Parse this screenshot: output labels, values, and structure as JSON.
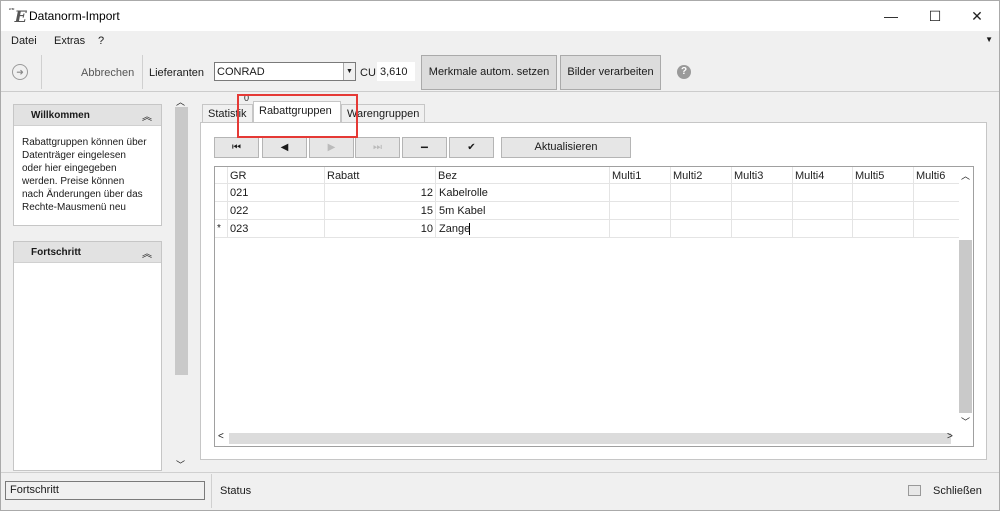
{
  "window": {
    "title": "Datanorm-Import",
    "minimize": "—",
    "maximize": "☐",
    "close": "✕",
    "logo": "E"
  },
  "menu": {
    "items": [
      "Datei",
      "Extras",
      "?"
    ]
  },
  "toolbar": {
    "abort_label": "Abbrechen",
    "supplier_label": "Lieferanten",
    "supplier_value": "CONRAD",
    "cu_label": "CU",
    "cu_value": "3,610",
    "auto_features_label": "Merkmale autom. setzen",
    "process_images_label": "Bilder verarbeiten"
  },
  "left_panel": {
    "welcome_title": "Willkommen",
    "welcome_text": "Rabattgruppen können über Datenträger eingelesen oder hier eingegeben werden. Preise können nach Änderungen über das Rechte-Mausmenü neu",
    "progress_title": "Fortschritt"
  },
  "tabs": {
    "hidden_label": "0",
    "items": [
      "Statistik",
      "Rabattgruppen",
      "Warengruppen"
    ],
    "active": 1
  },
  "nav": {
    "refresh_label": "Aktualisieren"
  },
  "grid": {
    "columns": [
      "GR",
      "Rabatt",
      "Bez",
      "Multi1",
      "Multi2",
      "Multi3",
      "Multi4",
      "Multi5",
      "Multi6"
    ],
    "rows": [
      {
        "marker": "",
        "gr": "021",
        "rabatt": "12",
        "bez": "Kabelrolle"
      },
      {
        "marker": "",
        "gr": "022",
        "rabatt": "15",
        "bez": "5m Kabel"
      },
      {
        "marker": "*",
        "gr": "023",
        "rabatt": "10",
        "bez": "Zange"
      }
    ]
  },
  "statusbar": {
    "progress_label": "Fortschritt",
    "status_label": "Status",
    "close_label": "Schließen"
  },
  "colors": {
    "highlight": "#e53935"
  }
}
